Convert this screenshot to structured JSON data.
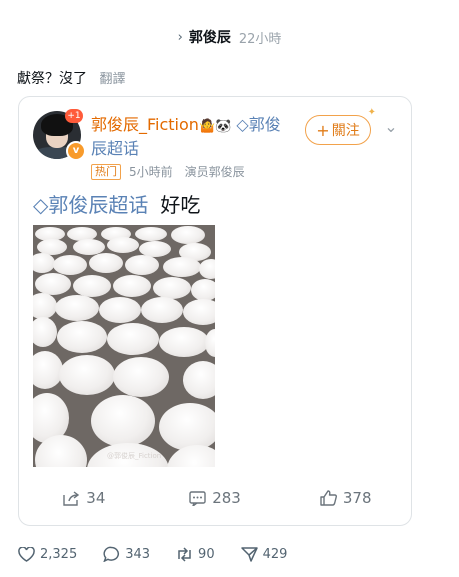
{
  "context": {
    "name": "郭俊辰",
    "time": "22小時"
  },
  "tweet": {
    "text": "獻祭？沒了",
    "translate": "翻譯"
  },
  "card": {
    "username": "郭俊辰_Fiction",
    "emoji": "🤷🐼",
    "super_topic_inline": "郭俊辰超话",
    "hot_label": "热门",
    "time": "5小時前",
    "source": "演员郭俊辰",
    "follow_label": "關注",
    "avatar_badge": "1",
    "post_tag": "郭俊辰超话",
    "post_text": "好吃",
    "watermark": "@郭俊辰_Fiction",
    "actions": {
      "repost": "34",
      "comment": "283",
      "like": "378"
    }
  },
  "footer": {
    "likes": "2,325",
    "replies": "343",
    "retweets": "90",
    "views": "429"
  },
  "colors": {
    "weibo_orange": "#e07b17",
    "super_topic_blue": "#5a82b5"
  }
}
